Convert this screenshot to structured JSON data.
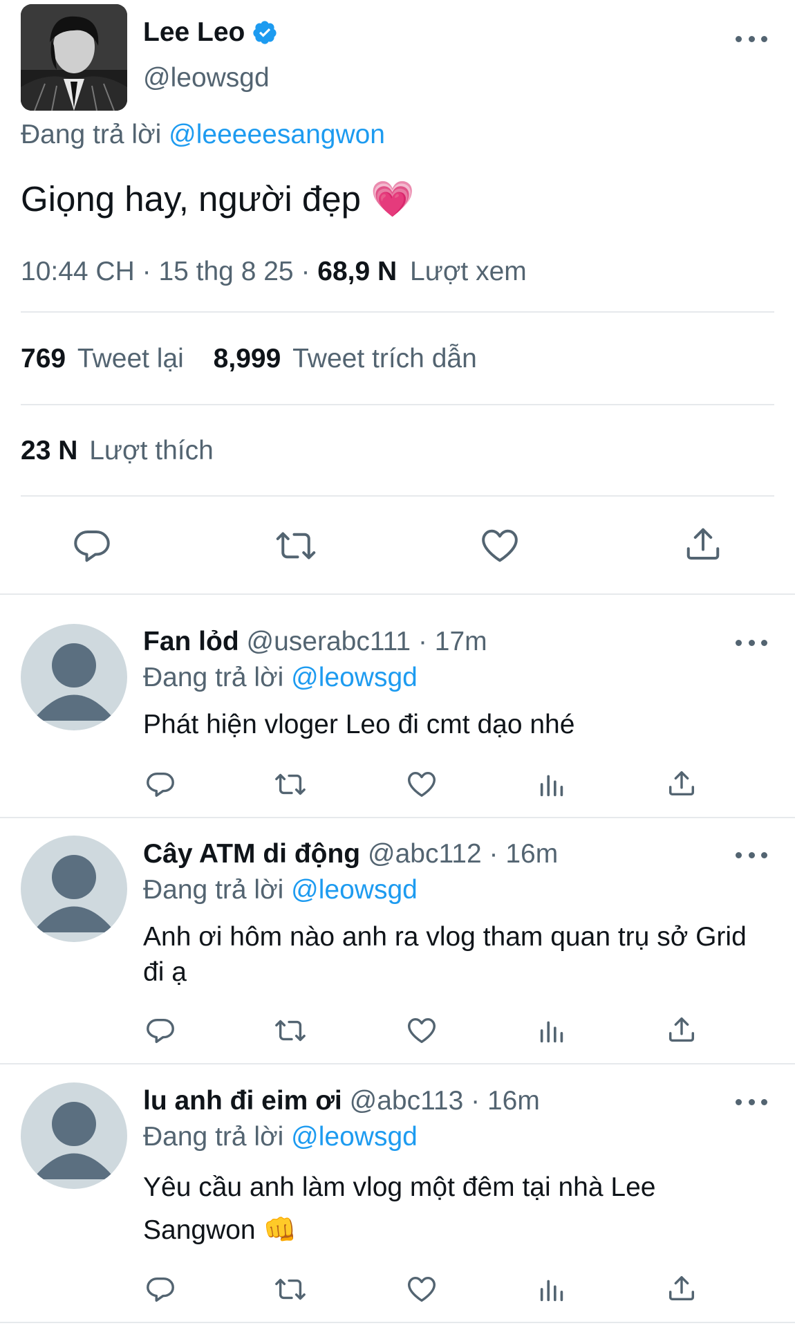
{
  "main_tweet": {
    "author_name": "Lee Leo",
    "author_handle": "@leowsgd",
    "reply_prefix": "Đang trả lời",
    "reply_to": "@leeeeesangwon",
    "text": "Giọng hay, người đẹp",
    "emoji": "💗",
    "time": "10:44 CH",
    "date": "15 thg 8 25",
    "views_count": "68,9 N",
    "views_label": "Lượt xem",
    "retweets_count": "769",
    "retweets_label": "Tweet lại",
    "quotes_count": "8,999",
    "quotes_label": "Tweet trích dẫn",
    "likes_count": "23 N",
    "likes_label": "Lượt thích",
    "icons": [
      "reply-icon",
      "retweet-icon",
      "like-icon",
      "share-icon"
    ]
  },
  "replies": [
    {
      "name": "Fan lỏd",
      "handle": "@userabc111",
      "time": "17m",
      "reply_prefix": "Đang trả lời",
      "reply_to": "@leowsgd",
      "text": "Phát hiện vloger Leo đi cmt dạo nhé"
    },
    {
      "name": "Cây ATM di động",
      "handle": "@abc112",
      "time": "16m",
      "reply_prefix": "Đang trả lời",
      "reply_to": "@leowsgd",
      "text": "Anh ơi hôm nào anh ra vlog tham quan trụ sở Grid đi ạ"
    },
    {
      "name": "lu anh đi eim ơi",
      "handle": "@abc113",
      "time": "16m",
      "reply_prefix": "Đang trả lời",
      "reply_to": "@leowsgd",
      "text": "Yêu cầu anh làm vlog một đêm tại nhà Lee Sangwon",
      "emoji": "👊"
    }
  ],
  "colors": {
    "accent": "#1d9bf0",
    "text": "#0f1419",
    "muted": "#536471",
    "divider": "#e6e9ec",
    "avatar_bg": "#cfd9de",
    "avatar_fg": "#5b6f80"
  }
}
